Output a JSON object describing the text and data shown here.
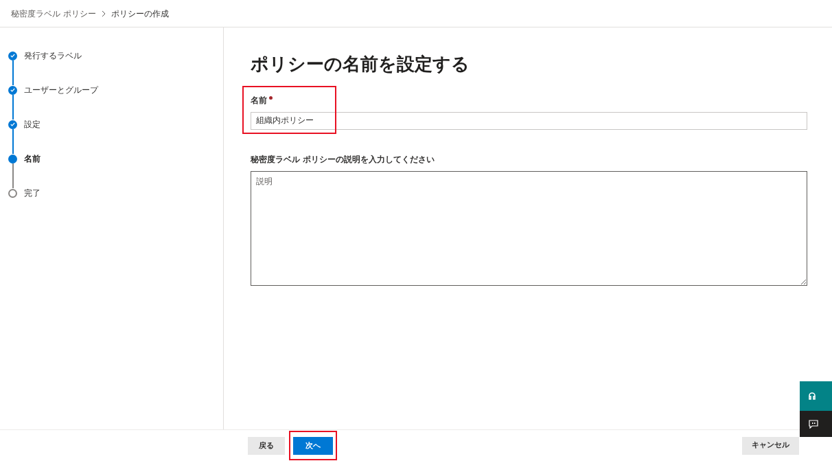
{
  "breadcrumb": [
    "秘密度ラベル ポリシー",
    "ポリシーの作成"
  ],
  "steps": [
    {
      "label": "発行するラベル",
      "kind": "done"
    },
    {
      "label": "ユーザーとグループ",
      "kind": "done"
    },
    {
      "label": "設定",
      "kind": "done"
    },
    {
      "label": "名前",
      "kind": "current"
    },
    {
      "label": "完了",
      "kind": "pending"
    }
  ],
  "title": "ポリシーの名前を設定する",
  "name_field": {
    "label": "名前",
    "required": true,
    "value": "組織内ポリシー",
    "highlighted": true
  },
  "description_field": {
    "label": "秘密度ラベル ポリシーの説明を入力してください",
    "placeholder": "説明"
  },
  "buttons": [
    {
      "label": "戻る",
      "kind": "secondary",
      "highlighted": false
    },
    {
      "label": "次へ",
      "kind": "primary",
      "highlighted": true
    }
  ],
  "cancel_button": {
    "label": "キャンセル"
  }
}
